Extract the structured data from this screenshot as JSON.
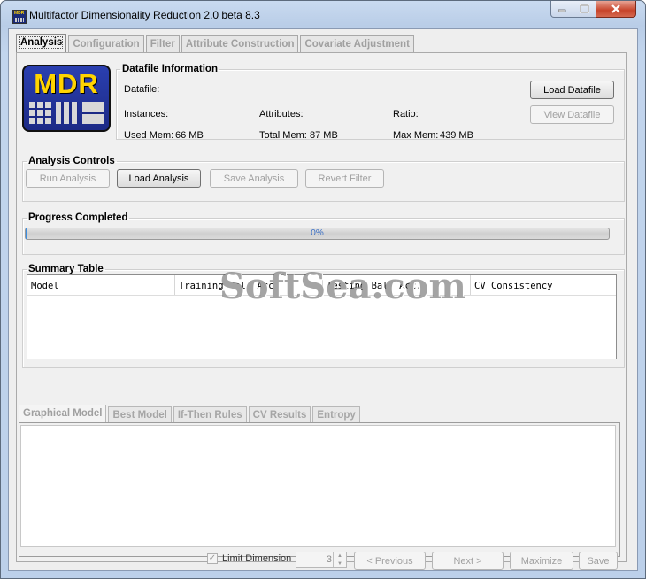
{
  "window": {
    "title": "Multifactor Dimensionality Reduction 2.0 beta 8.3",
    "app_icon": "mdr-app-icon",
    "controls": [
      "minimize",
      "maximize",
      "close"
    ]
  },
  "main_tabs": [
    {
      "label": "Analysis",
      "active": true,
      "enabled": true
    },
    {
      "label": "Configuration",
      "active": false,
      "enabled": false
    },
    {
      "label": "Filter",
      "active": false,
      "enabled": false
    },
    {
      "label": "Attribute Construction",
      "active": false,
      "enabled": false
    },
    {
      "label": "Covariate Adjustment",
      "active": false,
      "enabled": false
    }
  ],
  "logo": {
    "text": "MDR"
  },
  "datafile_info": {
    "title": "Datafile Information",
    "datafile_label": "Datafile:",
    "datafile_value": "",
    "instances_label": "Instances:",
    "instances_value": "",
    "attributes_label": "Attributes:",
    "attributes_value": "",
    "ratio_label": "Ratio:",
    "ratio_value": "",
    "used_mem_label": "Used Mem:",
    "used_mem_value": "66 MB",
    "total_mem_label": "Total Mem:",
    "total_mem_value": "87 MB",
    "max_mem_label": "Max Mem:",
    "max_mem_value": "439 MB",
    "load_button": "Load Datafile",
    "view_button": "View Datafile"
  },
  "analysis_controls": {
    "title": "Analysis Controls",
    "run_button": "Run Analysis",
    "load_button": "Load Analysis",
    "save_button": "Save Analysis",
    "revert_button": "Revert Filter"
  },
  "progress": {
    "title": "Progress Completed",
    "percent": 0,
    "text": "0%",
    "color": "#3d8ee0"
  },
  "summary_table": {
    "title": "Summary Table",
    "columns": [
      "Model",
      "Training Bal. Acc.",
      "Testing Bal. Acc.",
      "CV Consistency"
    ],
    "rows": []
  },
  "graph_tabs": [
    {
      "label": "Graphical Model",
      "active": true
    },
    {
      "label": "Best Model",
      "active": false
    },
    {
      "label": "If-Then Rules",
      "active": false
    },
    {
      "label": "CV Results",
      "active": false
    },
    {
      "label": "Entropy",
      "active": false
    }
  ],
  "bottom_controls": {
    "limit_dimension_label": "Limit Dimension",
    "limit_dimension_checked": true,
    "dimension_value": "3",
    "previous_button": "< Previous",
    "next_button": "Next >",
    "maximize_button": "Maximize",
    "save_button": "Save"
  },
  "watermark": "SoftSea.com"
}
